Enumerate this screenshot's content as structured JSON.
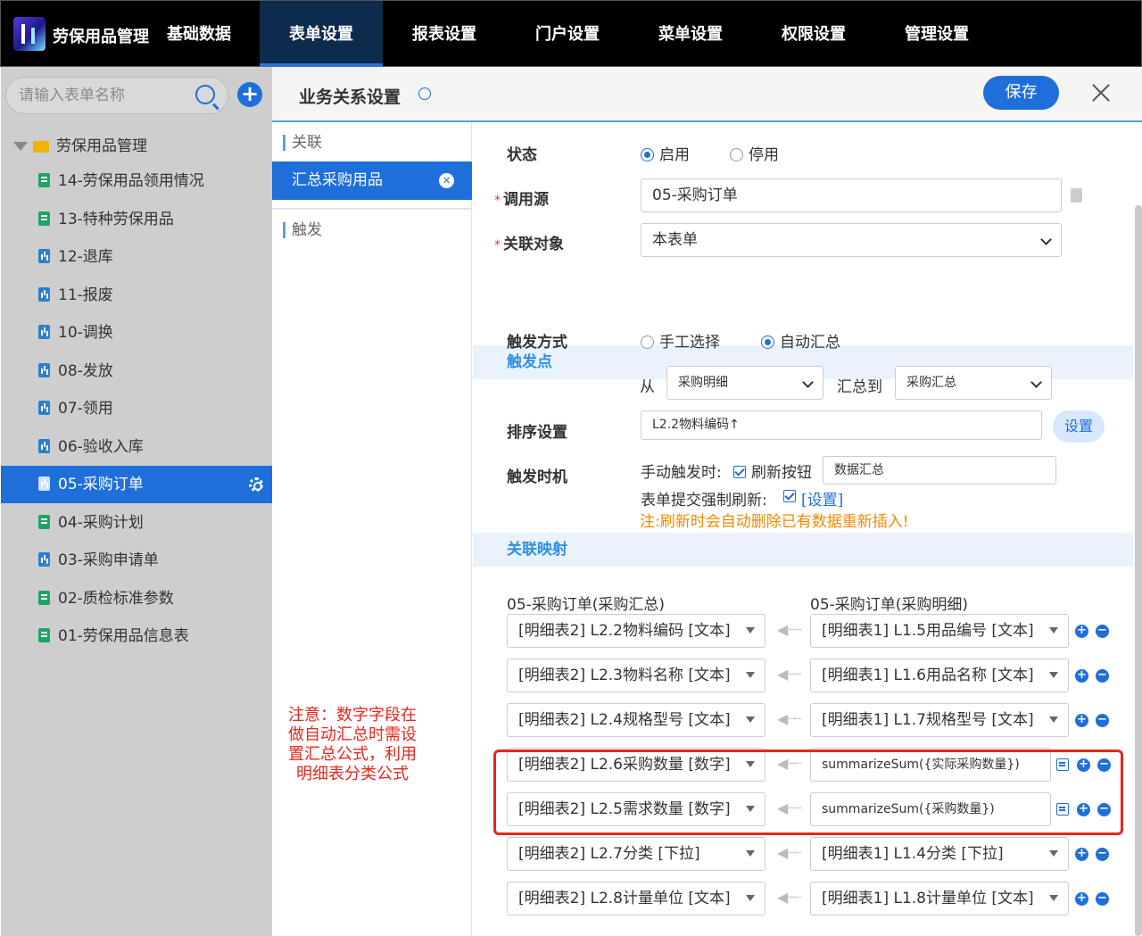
{
  "app": {
    "name": "劳保用品管理"
  },
  "nav": {
    "items": [
      "基础数据",
      "表单设置",
      "报表设置",
      "门户设置",
      "菜单设置",
      "权限设置",
      "管理设置"
    ],
    "active_index": 1
  },
  "sidebar": {
    "search_placeholder": "请输入表单名称",
    "root_label": "劳保用品管理",
    "items": [
      {
        "label": "14-劳保用品领用情况",
        "icon": "green-doc-icon"
      },
      {
        "label": "13-特种劳保用品",
        "icon": "green-doc-icon"
      },
      {
        "label": "12-退库",
        "icon": "blue-doc-icon"
      },
      {
        "label": "11-报废",
        "icon": "blue-doc-icon"
      },
      {
        "label": "10-调换",
        "icon": "blue-doc-icon"
      },
      {
        "label": "08-发放",
        "icon": "blue-doc-icon"
      },
      {
        "label": "07-领用",
        "icon": "blue-doc-icon"
      },
      {
        "label": "06-验收入库",
        "icon": "blue-doc-icon"
      },
      {
        "label": "05-采购订单",
        "icon": "blue-doc-icon",
        "selected": true
      },
      {
        "label": "04-采购计划",
        "icon": "green-doc-icon"
      },
      {
        "label": "03-采购申请单",
        "icon": "blue-doc-icon"
      },
      {
        "label": "02-质检标准参数",
        "icon": "green-doc-icon"
      },
      {
        "label": "01-劳保用品信息表",
        "icon": "green-doc-icon"
      }
    ]
  },
  "panel": {
    "title": "业务关系设置",
    "save_label": "保存",
    "left": {
      "section_link": "关联",
      "relation_item": "汇总采购用品",
      "section_trigger": "触发"
    },
    "form": {
      "status_label": "状态",
      "status_on": "启用",
      "status_off": "停用",
      "source_label": "调用源",
      "source_value": "05-采购订单",
      "target_label": "关联对象",
      "target_value": "本表单",
      "trigger_band": "触发点",
      "trigger_mode_label": "触发方式",
      "mode_manual": "手工选择",
      "mode_auto": "自动汇总",
      "from_label": "从",
      "from_value": "采购明细",
      "to_label": "汇总到",
      "to_value": "采购汇总",
      "sort_label": "排序设置",
      "sort_value": "L2.2物料编码↑",
      "sort_button": "设置",
      "timing_label": "触发时机",
      "manual_trigger_label": "手动触发时:",
      "refresh_button_label": "刷新按钮",
      "refresh_button_value": "数据汇总",
      "force_refresh_label": "表单提交强制刷新:",
      "force_refresh_link": "[设置]",
      "warning": "注:刷新时会自动删除已有数据重新插入!",
      "mapping_band": "关联映射",
      "left_header": "05-采购订单(采购汇总)",
      "right_header": "05-采购订单(采购明细)",
      "mappings": [
        {
          "left": "[明细表2] L2.2物料编码 [文本]",
          "right": "[明细表1] L1.5用品编号 [文本]",
          "formula": false
        },
        {
          "left": "[明细表2] L2.3物料名称 [文本]",
          "right": "[明细表1] L1.6用品名称 [文本]",
          "formula": false
        },
        {
          "left": "[明细表2] L2.4规格型号 [文本]",
          "right": "[明细表1] L1.7规格型号 [文本]",
          "formula": false
        },
        {
          "left": "[明细表2] L2.6采购数量 [数字]",
          "right": "summarizeSum({实际采购数量})",
          "formula": true
        },
        {
          "left": "[明细表2] L2.5需求数量 [数字]",
          "right": "summarizeSum({采购数量})",
          "formula": true
        },
        {
          "left": "[明细表2] L2.7分类 [下拉]",
          "right": "[明细表1] L1.4分类 [下拉]",
          "formula": false
        },
        {
          "left": "[明细表2] L2.8计量单位 [文本]",
          "right": "[明细表1] L1.8计量单位 [文本]",
          "formula": false
        }
      ]
    }
  },
  "annotation": {
    "note": "注意：数字字段在做自动汇总时需设置汇总公式，利用明细表分类公式",
    "color": "#e8261c"
  }
}
